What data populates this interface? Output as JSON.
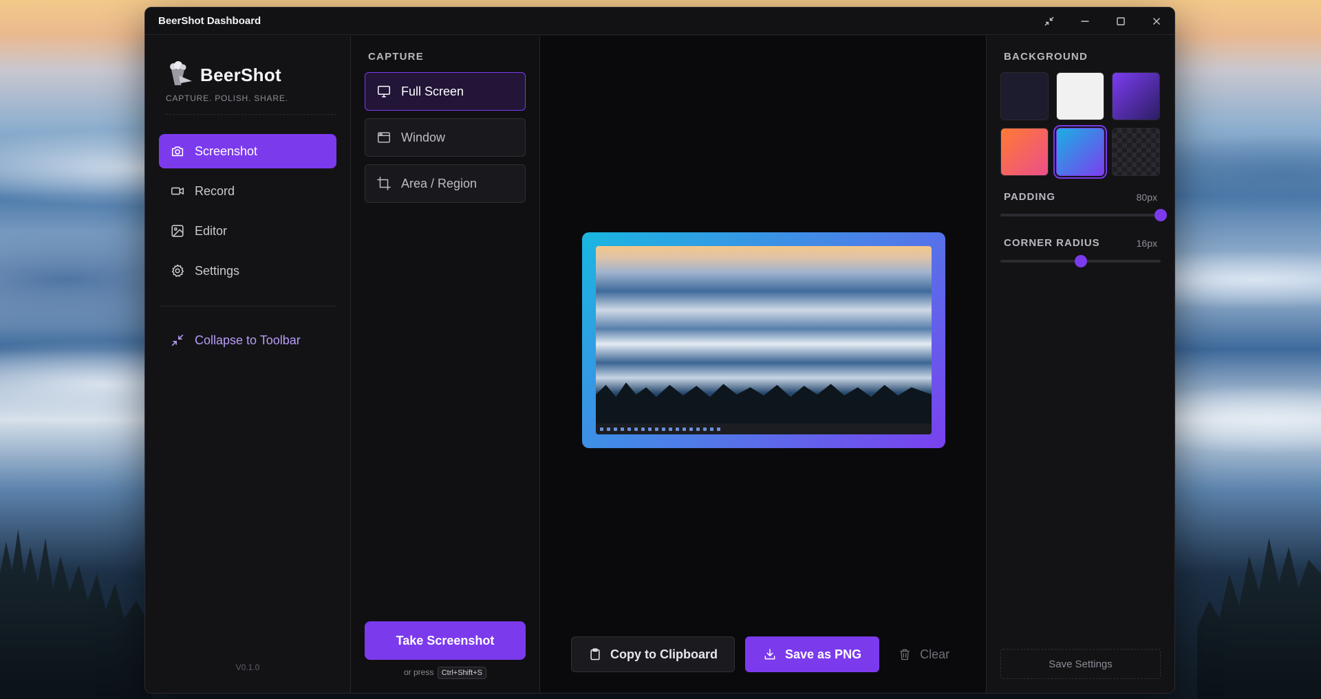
{
  "window": {
    "title": "BeerShot Dashboard"
  },
  "sidebar": {
    "brand_name": "BeerShot",
    "tagline": "CAPTURE. POLISH. SHARE.",
    "items": [
      {
        "label": "Screenshot",
        "icon": "camera-icon",
        "active": true
      },
      {
        "label": "Record",
        "icon": "video-icon",
        "active": false
      },
      {
        "label": "Editor",
        "icon": "image-icon",
        "active": false
      },
      {
        "label": "Settings",
        "icon": "gear-icon",
        "active": false
      }
    ],
    "collapse_label": "Collapse to Toolbar",
    "version": "V0.1.0"
  },
  "capture": {
    "heading": "CAPTURE",
    "options": [
      {
        "label": "Full Screen",
        "icon": "monitor-icon",
        "active": true
      },
      {
        "label": "Window",
        "icon": "window-icon",
        "active": false
      },
      {
        "label": "Area / Region",
        "icon": "crop-icon",
        "active": false
      }
    ],
    "take_button": "Take Screenshot",
    "hint_prefix": "or press",
    "shortcut": "Ctrl+Shift+S"
  },
  "actions": {
    "copy": "Copy to Clipboard",
    "save_png": "Save as PNG",
    "clear": "Clear"
  },
  "background": {
    "heading": "BACKGROUND",
    "selected": "ocean",
    "swatches": [
      "navy",
      "white",
      "purple",
      "sunset",
      "ocean",
      "transparent"
    ],
    "padding_label": "PADDING",
    "padding_value": "80px",
    "padding_fraction": 1.0,
    "radius_label": "CORNER RADIUS",
    "radius_value": "16px",
    "radius_fraction": 0.5,
    "save_settings": "Save Settings"
  },
  "colors": {
    "accent": "#7c3aed",
    "window_bg": "#101013"
  }
}
